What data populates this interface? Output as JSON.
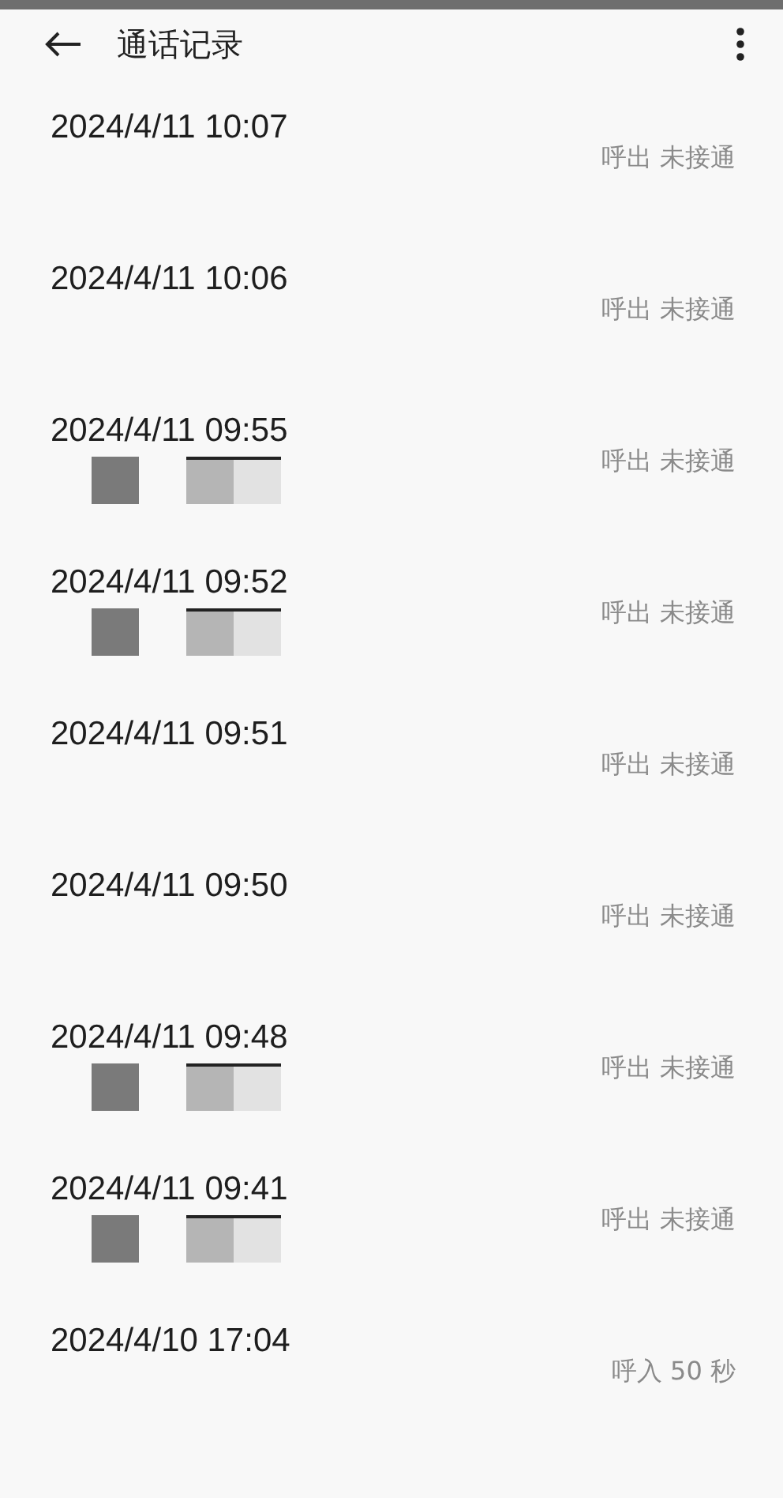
{
  "header": {
    "title": "通话记录"
  },
  "calls": [
    {
      "time": "2024/4/11 10:07",
      "status": "呼出 未接通",
      "redacted": false
    },
    {
      "time": "2024/4/11 10:06",
      "status": "呼出 未接通",
      "redacted": false
    },
    {
      "time": "2024/4/11 09:55",
      "status": "呼出 未接通",
      "redacted": true
    },
    {
      "time": "2024/4/11 09:52",
      "status": "呼出 未接通",
      "redacted": true
    },
    {
      "time": "2024/4/11 09:51",
      "status": "呼出 未接通",
      "redacted": false
    },
    {
      "time": "2024/4/11 09:50",
      "status": "呼出 未接通",
      "redacted": false
    },
    {
      "time": "2024/4/11 09:48",
      "status": "呼出 未接通",
      "redacted": true
    },
    {
      "time": "2024/4/11 09:41",
      "status": "呼出 未接通",
      "redacted": true
    },
    {
      "time": "2024/4/10 17:04",
      "status": "呼入 50 秒",
      "redacted": false
    }
  ]
}
